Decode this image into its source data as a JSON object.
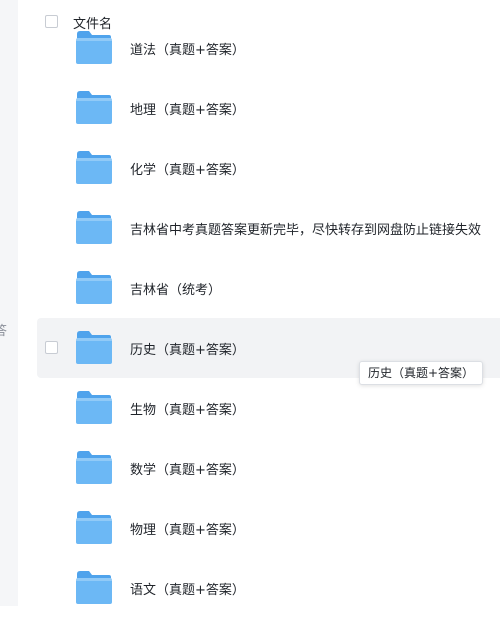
{
  "sidebar": {
    "clipped_text": "答"
  },
  "table": {
    "header": {
      "name_column": "文件名"
    },
    "rows": [
      {
        "name": "道法（真题+答案）"
      },
      {
        "name": "地理（真题+答案）"
      },
      {
        "name": "化学（真题+答案）"
      },
      {
        "name": "吉林省中考真题答案更新完毕，尽快转存到网盘防止链接失效"
      },
      {
        "name": "吉林省（统考）"
      },
      {
        "name": "历史（真题+答案）"
      },
      {
        "name": "生物（真题+答案）"
      },
      {
        "name": "数学（真题+答案）"
      },
      {
        "name": "物理（真题+答案）"
      },
      {
        "name": "语文（真题+答案）"
      }
    ],
    "hovered_row": 5
  },
  "tooltip": {
    "text": "历史（真题+答案）"
  },
  "icons": {
    "row_icon": "folder-icon"
  },
  "colors": {
    "folder_body": "#6cb8f5",
    "folder_tab": "#4fa3ec",
    "hover_bg": "#f2f3f5"
  }
}
